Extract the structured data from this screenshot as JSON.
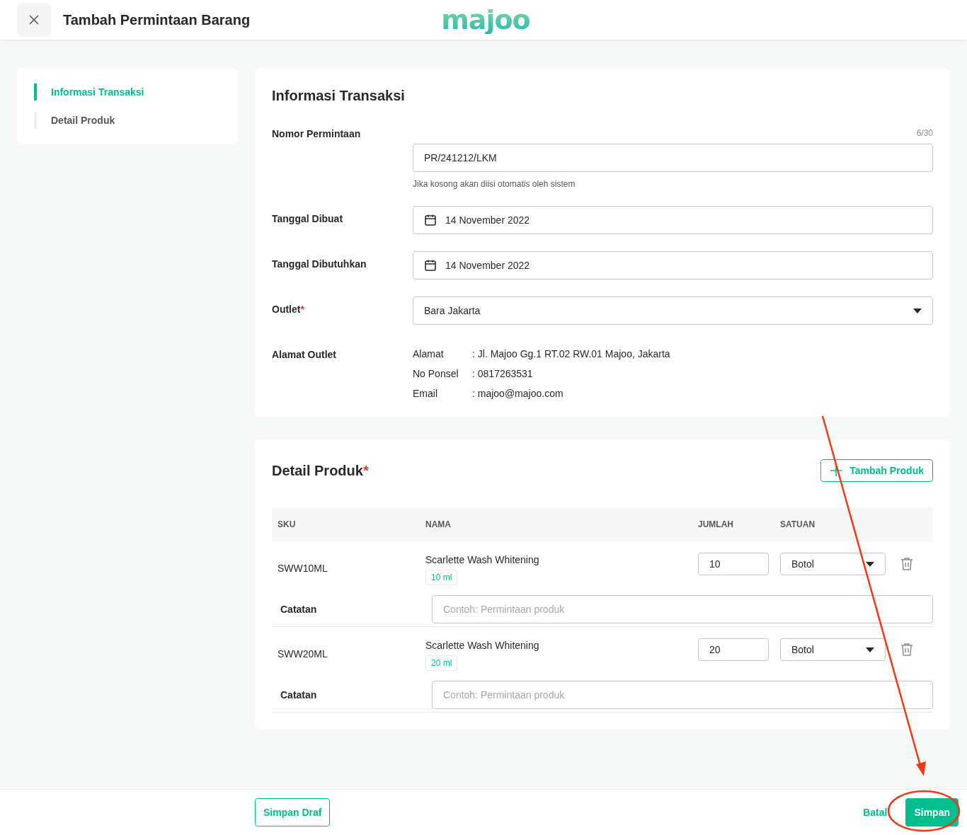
{
  "header": {
    "title": "Tambah Permintaan Barang",
    "logo": "majoo"
  },
  "steps": [
    {
      "label": "Informasi Transaksi",
      "selected": true
    },
    {
      "label": "Detail Produk",
      "selected": false
    }
  ],
  "transaction": {
    "title": "Informasi Transaksi",
    "fields": [
      {
        "kind": "text",
        "label": "Nomor Permintaan",
        "counter": "6/30",
        "value": "PR/241212/LKM",
        "hint": "Jika kosong akan diisi otomatis oleh sistem"
      },
      {
        "kind": "date",
        "label": "Tanggal Dibuat",
        "value": "14 November 2022"
      },
      {
        "kind": "date",
        "label": "Tanggal Dibutuhkan",
        "value": "14 November 2022"
      },
      {
        "kind": "select",
        "label": "Outlet",
        "required_mark": "*",
        "value": "Bara Jakarta"
      },
      {
        "kind": "address",
        "label": "Alamat Outlet",
        "lines": [
          {
            "key": "Alamat",
            "value": ": Jl. Majoo Gg.1 RT.02 RW.01 Majoo, Jakarta"
          },
          {
            "key": "No Ponsel",
            "value": ": 0817263531"
          },
          {
            "key": "Email",
            "value": ": majoo@majoo.com"
          }
        ]
      }
    ]
  },
  "products": {
    "title": "Detail Produk",
    "required_mark": "*",
    "add_button": "Tambah Produk",
    "columns": [
      "SKU",
      "NAMA",
      "JUMLAH",
      "SATUAN"
    ],
    "rows": [
      {
        "sku": "SWW10ML",
        "name": "Scarlette Wash Whitening",
        "variant": "10 ml",
        "quantity": "10",
        "unit": "Botol",
        "note_label": "Catatan",
        "note_placeholder": "Contoh: Permintaan produk"
      },
      {
        "sku": "SWW20ML",
        "name": "Scarlette Wash Whitening",
        "variant": "20 ml",
        "quantity": "20",
        "unit": "Botol",
        "note_label": "Catatan",
        "note_placeholder": "Contoh: Permintaan produk"
      }
    ]
  },
  "footer": {
    "draft_button": "Simpan Draf",
    "cancel_button": "Batal",
    "save_button": "Simpan"
  }
}
